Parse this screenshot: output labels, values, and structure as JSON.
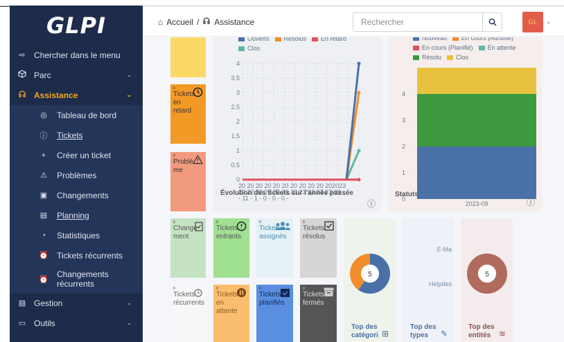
{
  "app": {
    "logo": "GLPI"
  },
  "breadcrumb": {
    "home": "Accueil",
    "separator": "/",
    "current": "Assistance"
  },
  "search": {
    "placeholder": "Rechercher"
  },
  "user": {
    "initials": "GL"
  },
  "sidebar": {
    "search_menu": "Chercher dans le menu",
    "items": [
      {
        "label": "Parc"
      },
      {
        "label": "Assistance"
      },
      {
        "label": "Gestion"
      },
      {
        "label": "Outils"
      }
    ],
    "sub": [
      {
        "label": "Tableau de bord"
      },
      {
        "label": "Tickets"
      },
      {
        "label": "Créer un ticket"
      },
      {
        "label": "Problèmes"
      },
      {
        "label": "Changements"
      },
      {
        "label": "Planning"
      },
      {
        "label": "Statistiques"
      },
      {
        "label": "Tickets récurrents"
      },
      {
        "label": "Changements récurrents"
      }
    ]
  },
  "tiles": {
    "late": {
      "num": "0",
      "label": "Tickets en retard"
    },
    "problems": {
      "num": "0",
      "label": "Problème"
    },
    "changes": {
      "num": "0",
      "label": "Change ment"
    },
    "incoming": {
      "num": "0",
      "label": "Tickets entrants"
    },
    "assigned": {
      "num": "0",
      "label": "Tickets assignés"
    },
    "solved": {
      "num": "0",
      "label": "Tickets résolus"
    },
    "recurring": {
      "num": "0",
      "label": "Tickets récurrents"
    },
    "waiting": {
      "num": "0",
      "label": "Tickets en attente"
    },
    "planned": {
      "num": "0",
      "label": "Tickets planifiés"
    },
    "closed": {
      "num": "0",
      "label": "Tickets fermés"
    }
  },
  "evolution": {
    "title": "Évolution des tickets sur l'année passée",
    "legend": [
      "Ouverts",
      "Résolus",
      "En retard",
      "Clos"
    ],
    "colors": [
      "#4a70a8",
      "#f08c2c",
      "#e0505a",
      "#5fb8a5"
    ],
    "y_ticks": [
      "4",
      "3.5",
      "3",
      "2.5",
      "2",
      "1.5",
      "1",
      "0.5",
      "0"
    ],
    "x_label_top": "20 20 20 20 20 20 20 20 20 20 202023",
    "x_label_bottom": "22 22 22 22 23 23 23 23 23 23 23-09",
    "x_label_third": "- 11 - 1 - 0 - 0 - 0 -"
  },
  "status": {
    "title": "Statuts des tickets par mois",
    "legend": [
      "Nouveau",
      "En cours (Attribué)",
      "En cours (Planifié)",
      "En attente",
      "Résolu",
      "Clos"
    ],
    "colors": [
      "#4a70a8",
      "#f08c2c",
      "#e0505a",
      "#5fb8a5",
      "#3d9a3f",
      "#e8c23e"
    ],
    "y_ticks": [
      "4",
      "3",
      "2",
      "1",
      "0"
    ],
    "x_label": "2023-09"
  },
  "chart_data": [
    {
      "type": "line",
      "title": "Évolution des tickets sur l'année passée",
      "y_range": [
        0,
        4
      ],
      "series": [
        {
          "name": "Ouverts",
          "end_value": 4
        },
        {
          "name": "Résolus",
          "end_value": 3
        },
        {
          "name": "En retard",
          "end_value": 0
        },
        {
          "name": "Clos",
          "end_value": 1
        }
      ]
    },
    {
      "type": "bar",
      "title": "Statuts des tickets par mois",
      "categories": [
        "2023-09"
      ],
      "series": [
        {
          "name": "Nouveau",
          "values": [
            2
          ]
        },
        {
          "name": "Résolu",
          "values": [
            2
          ]
        },
        {
          "name": "Clos",
          "values": [
            1
          ]
        }
      ]
    },
    {
      "type": "pie",
      "title": "Top des catégories",
      "total": "5",
      "slices": [
        {
          "color": "#4a70a8",
          "value": 3
        },
        {
          "color": "#f08c2c",
          "value": 2
        }
      ]
    },
    {
      "type": "pie",
      "title": "Top des entités",
      "total": "5",
      "slices": [
        {
          "color": "#b06b5e",
          "value": 5
        }
      ]
    }
  ],
  "widgets": {
    "categories": {
      "title": "Top des catégori",
      "total": "5"
    },
    "types": {
      "title": "Top des types",
      "labels": [
        "E-Ma",
        "Helpdes"
      ]
    },
    "entities": {
      "title": "Top des entités",
      "total": "5"
    }
  }
}
